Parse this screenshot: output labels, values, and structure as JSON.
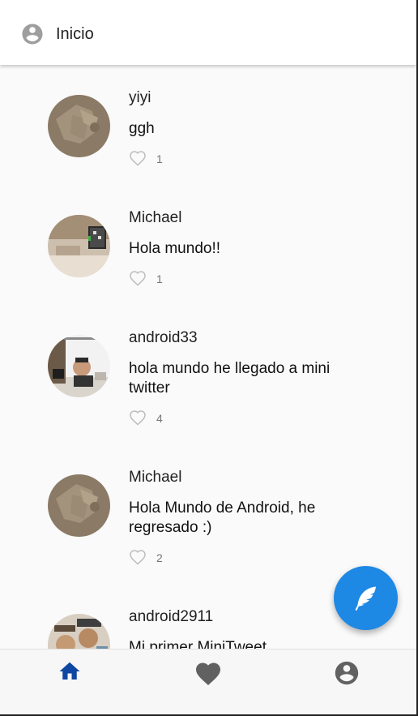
{
  "app_bar": {
    "title": "Inicio",
    "icon": "account-circle-icon"
  },
  "tweets": [
    {
      "username": "yiyi",
      "message": "ggh",
      "likes": "1",
      "avatar": "avatar-yiyi"
    },
    {
      "username": "Michael",
      "message": "Hola mundo!!",
      "likes": "1",
      "avatar": "avatar-michael-room"
    },
    {
      "username": "android33",
      "message": "hola mundo he llegado a mini twitter",
      "likes": "4",
      "avatar": "avatar-android33"
    },
    {
      "username": "Michael",
      "message": "Hola Mundo de Android, he regresado :)",
      "likes": "2",
      "avatar": "avatar-michael"
    },
    {
      "username": "android2911",
      "message": "Mi primer MiniTweet",
      "likes": "",
      "avatar": "avatar-android2911"
    }
  ],
  "fab": {
    "icon": "feather-icon"
  },
  "bottom_nav": {
    "items": [
      {
        "name": "home",
        "icon": "home-icon",
        "active": true
      },
      {
        "name": "favorites",
        "icon": "heart-icon",
        "active": false
      },
      {
        "name": "profile",
        "icon": "account-circle-icon",
        "active": false
      }
    ]
  },
  "colors": {
    "accent": "#1e88e5",
    "nav_active": "#0d47a1",
    "nav_inactive": "#616161",
    "background": "#fafafa"
  }
}
